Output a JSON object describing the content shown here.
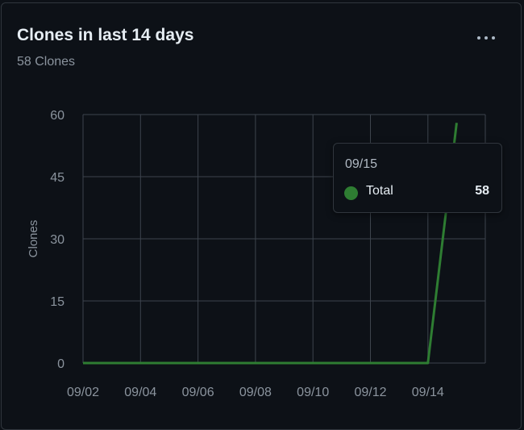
{
  "card": {
    "title": "Clones in last 14 days",
    "subtitle": "58 Clones",
    "menu_icon": "kebab-horizontal-icon"
  },
  "tooltip": {
    "date": "09/15",
    "series_label": "Total",
    "value": "58",
    "dot_color": "#2e7d32"
  },
  "colors": {
    "background": "#0d1117",
    "grid": "#3d444d",
    "line": "#2e7d32",
    "axis_text": "#8b949e"
  },
  "chart_data": {
    "type": "line",
    "title": "Clones in last 14 days",
    "xlabel": "",
    "ylabel": "Clones",
    "ylim": [
      0,
      60
    ],
    "yticks": [
      0,
      15,
      30,
      45,
      60
    ],
    "xticks": [
      "09/02",
      "09/04",
      "09/06",
      "09/08",
      "09/10",
      "09/12",
      "09/14"
    ],
    "x": [
      "09/02",
      "09/03",
      "09/04",
      "09/05",
      "09/06",
      "09/07",
      "09/08",
      "09/09",
      "09/10",
      "09/11",
      "09/12",
      "09/13",
      "09/14",
      "09/15"
    ],
    "series": [
      {
        "name": "Total",
        "values": [
          0,
          0,
          0,
          0,
          0,
          0,
          0,
          0,
          0,
          0,
          0,
          0,
          0,
          58
        ]
      }
    ],
    "grid": true
  }
}
